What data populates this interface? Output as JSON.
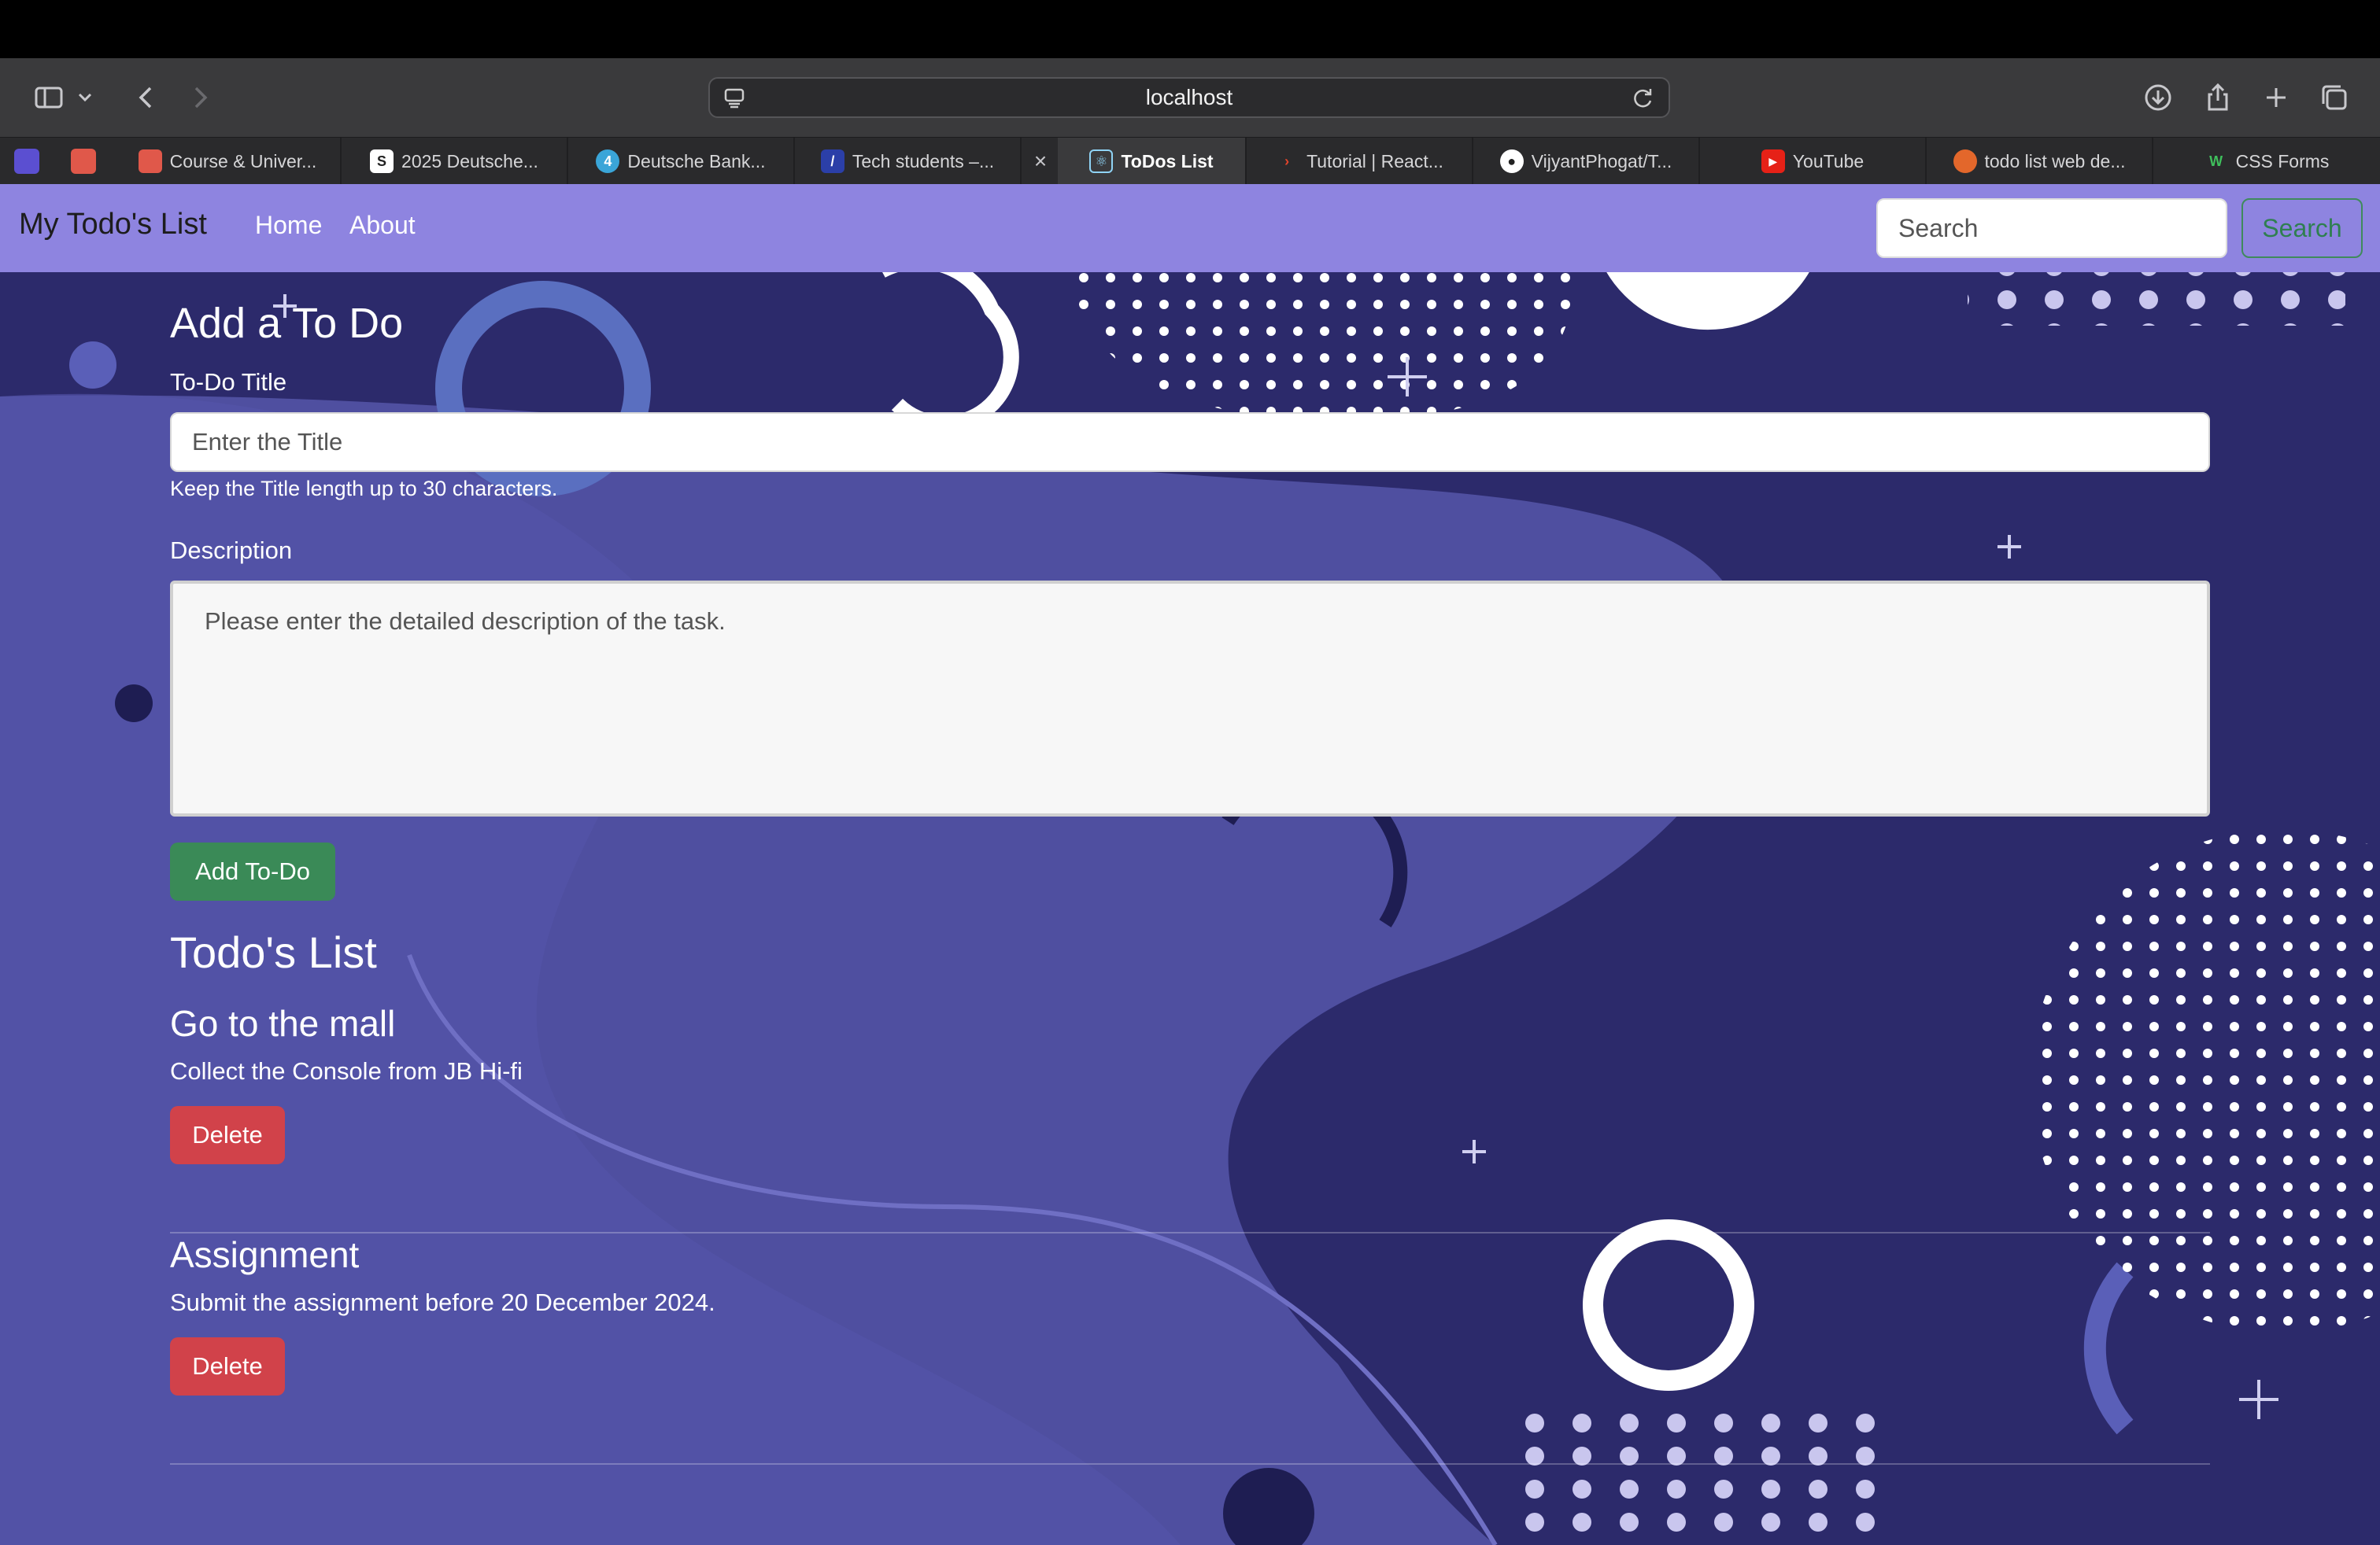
{
  "browser": {
    "url": "localhost",
    "tabs": [
      {
        "label": "Course & Univer...",
        "fav_color": "#e0584a"
      },
      {
        "label": "2025 Deutsche...",
        "fav_color": "#222222"
      },
      {
        "label": "Deutsche Bank...",
        "fav_color": "#3aa5d8"
      },
      {
        "label": "Tech students –...",
        "fav_color": "#2b3fa8"
      },
      {
        "label": "ToDos List",
        "fav_color": "#3a3a3c",
        "active": true
      },
      {
        "label": "Tutorial | React...",
        "fav_color": "#2a2a2c"
      },
      {
        "label": "VijyantPhogat/T...",
        "fav_color": "#ffffff"
      },
      {
        "label": "YouTube",
        "fav_color": "#e62117"
      },
      {
        "label": "todo list web de...",
        "fav_color": "#e3672b"
      },
      {
        "label": "CSS Forms",
        "fav_color": "#2a2a2c"
      }
    ]
  },
  "navbar": {
    "brand": "My Todo's List",
    "links": [
      "Home",
      "About"
    ],
    "search_placeholder": "Search",
    "search_button": "Search"
  },
  "form": {
    "heading": "Add a To Do",
    "title_label": "To-Do Title",
    "title_placeholder": "Enter the Title",
    "title_help": "Keep the Title length up to 30 characters.",
    "desc_label": "Description",
    "desc_placeholder": "Please enter the detailed description of the task.",
    "submit_label": "Add To-Do"
  },
  "list": {
    "heading": "Todo's List",
    "items": [
      {
        "title": "Go to the mall",
        "desc": "Collect the Console from JB Hi-fi",
        "delete_label": "Delete"
      },
      {
        "title": "Assignment",
        "desc": "Submit the assignment before 20 December 2024.",
        "delete_label": "Delete"
      }
    ]
  },
  "colors": {
    "navbar": "#8e84e0",
    "page_bg": "#2c2a6b",
    "add_button": "#3a8a57",
    "delete_button": "#d1424a"
  }
}
